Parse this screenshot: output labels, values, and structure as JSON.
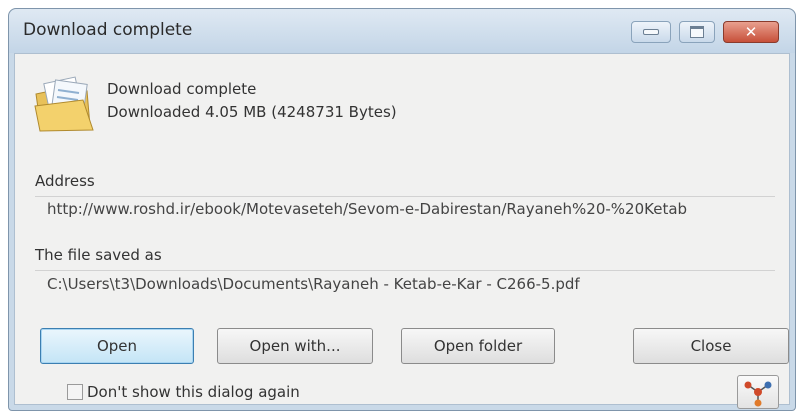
{
  "window": {
    "title": "Download complete",
    "controls": {
      "minimize": "minimize-icon",
      "maximize": "maximize-icon",
      "close": "close-icon",
      "close_glyph": "✕"
    }
  },
  "status": {
    "icon": "folder-document-icon",
    "line1": "Download complete",
    "line2": "Downloaded 4.05  MB (4248731 Bytes)"
  },
  "address": {
    "label": "Address",
    "value": "http://www.roshd.ir/ebook/Motevaseteh/Sevom-e-Dabirestan/Rayaneh%20-%20Ketab"
  },
  "saved_as": {
    "label": "The file saved as",
    "value": "C:\\Users\\t3\\Downloads\\Documents\\Rayaneh - Ketab-e-Kar - C266-5.pdf"
  },
  "buttons": {
    "open": "Open",
    "open_with": "Open with...",
    "open_folder": "Open folder",
    "close": "Close"
  },
  "options": {
    "dont_show_again": "Don't show this dialog again",
    "dont_show_checked": false,
    "network_icon": "network-icon"
  },
  "colors": {
    "title_bar": "#c9d9e8",
    "client_bg": "#f1f1f0",
    "close_button": "#c7503a",
    "default_button_border": "#3c7fb1"
  }
}
